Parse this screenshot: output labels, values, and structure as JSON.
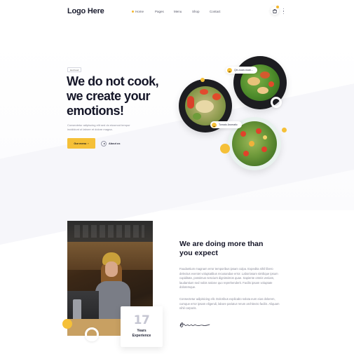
{
  "header": {
    "logo": "Logo Here",
    "nav": {
      "home": "Home",
      "pages": "Pages",
      "menu": "Menu",
      "shop": "Shop",
      "contact": "Contact"
    },
    "icons": {
      "cart": "cart-icon",
      "menu": "more-vertical-icon"
    }
  },
  "hero": {
    "tag": "Hot Food",
    "title_line1": "We do not cook,",
    "title_line2": "we create your",
    "title_line3": "emotions!",
    "text": "Consectetur adipiscing elit sed do eiusmod tempor incididunt ut labore et dolore magna.",
    "primary_button": "Our menu",
    "secondary_button": "About us",
    "label_top": "Qin-nuan-nuan...",
    "label_bottom": "Tomato Aromatic"
  },
  "about": {
    "title_line1": "We are doing more than",
    "title_line2": "you expect",
    "paragraph1": "Faudantium magnam error temporibus ipsam culpa. Expedita nihil libero delectus eveniet voluptatibus recusandae error. Laboriosam similique ipsum cupiditate, possimus nesciunt dignissimos quae. Sapiente omnis veniam, laudantium sed nobis ratione quo reprehenderit. Facilis ipsam voluptate doloremque.",
    "paragraph2": "Consectetur adipisicing elit. Doloribus explicabo soluta eum eius dolorem, cumque error ipsam eligendi, labore pariatur rerum architecto facilis. Aliquam nihil corporis.",
    "years_number": "17",
    "years_label1": "Years",
    "years_label2": "Experience"
  },
  "colors": {
    "accent": "#f5c038",
    "text_dark": "#141527",
    "text_muted": "#8a8b99"
  }
}
